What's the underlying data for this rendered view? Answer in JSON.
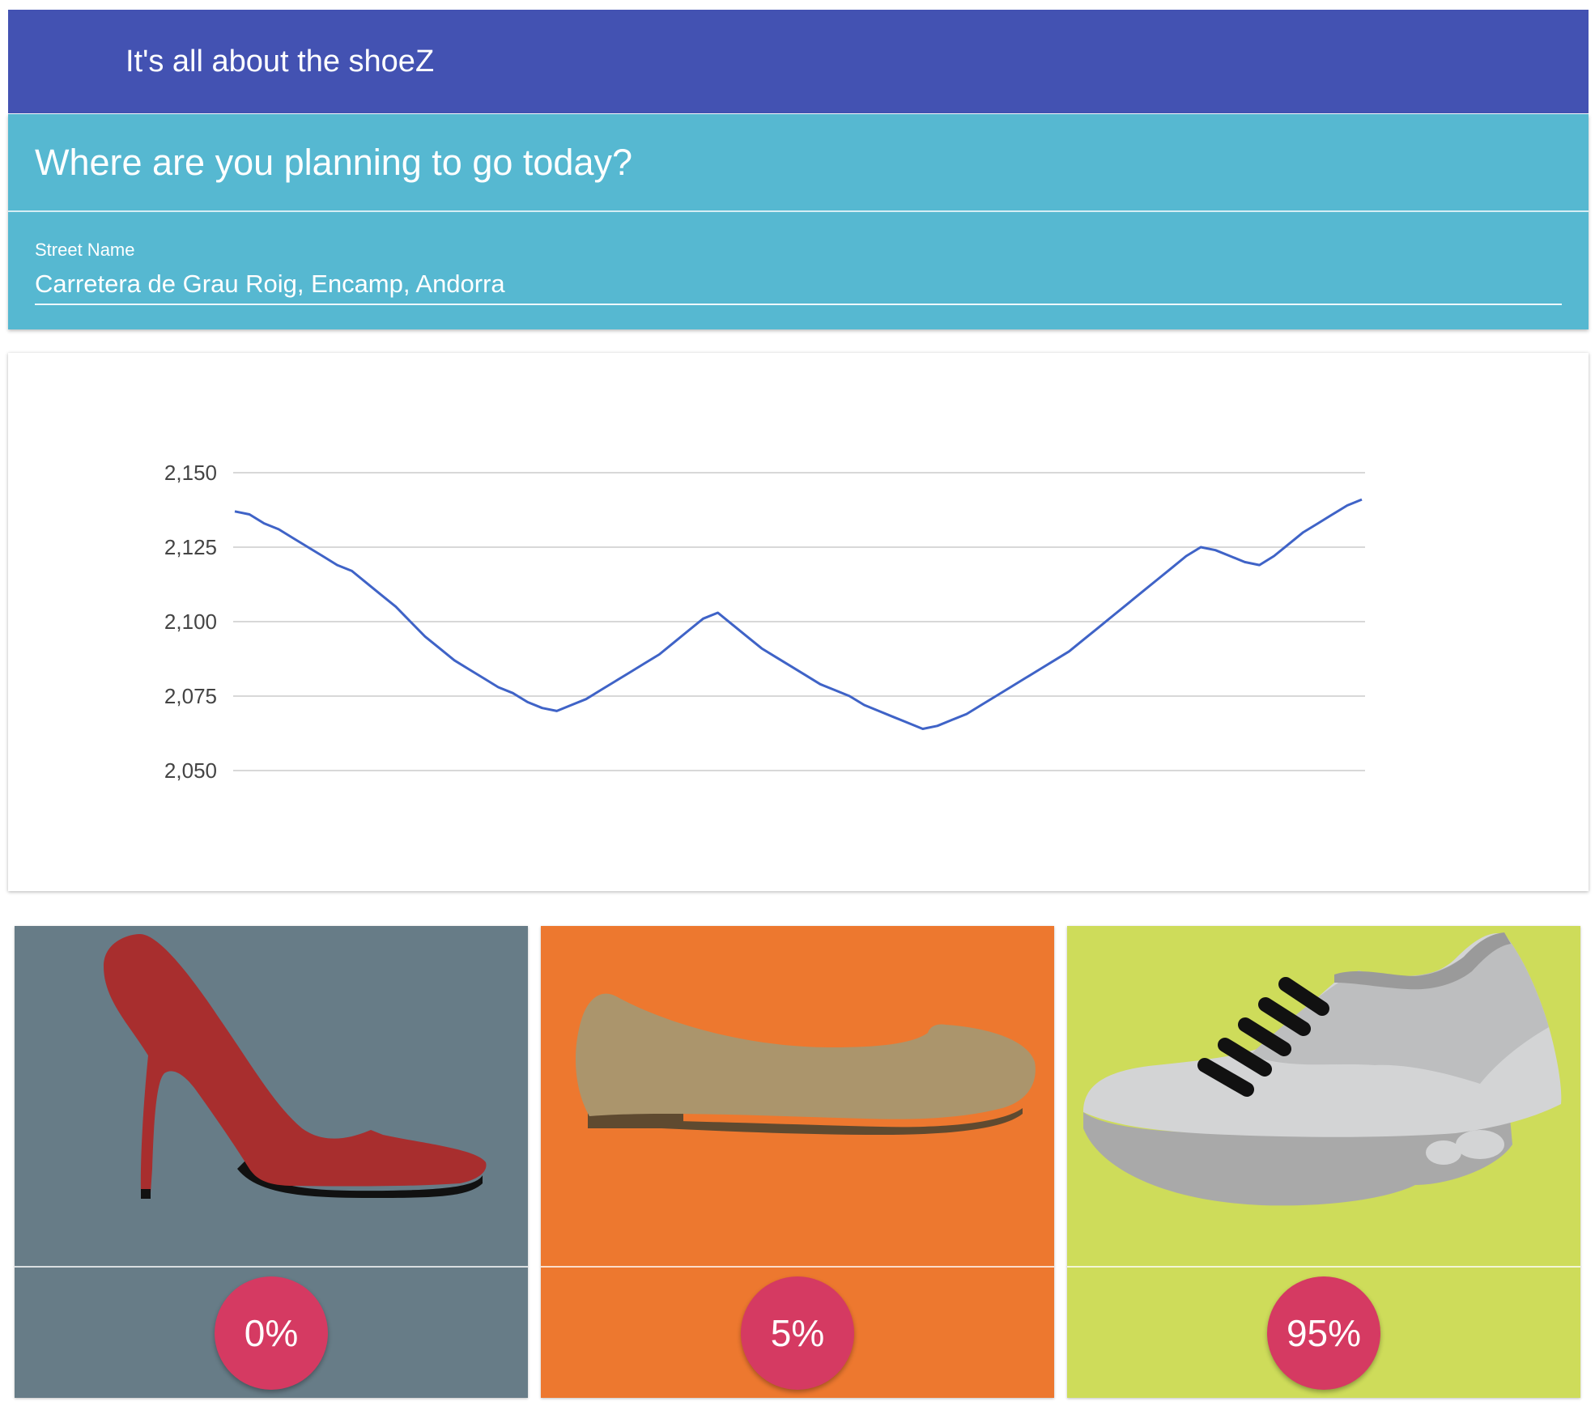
{
  "app": {
    "title": "It's all about the shoeZ",
    "toolbar_color": "#4352b2"
  },
  "search": {
    "heading": "Where are you planning to go today?",
    "field_label": "Street Name",
    "field_value": "Carretera de Grau Roig, Encamp, Andorra",
    "card_color": "#56b8d1"
  },
  "chart_data": {
    "type": "line",
    "title": "",
    "xlabel": "",
    "ylabel": "",
    "ylim": [
      2050,
      2150
    ],
    "yticks": [
      2050,
      2075,
      2100,
      2125,
      2150
    ],
    "ytick_labels": [
      "2,050",
      "2,075",
      "2,100",
      "2,125",
      "2,150"
    ],
    "grid": true,
    "legend": "none",
    "series": [
      {
        "color": "#3f63c7",
        "values": [
          2137,
          2136,
          2133,
          2131,
          2128,
          2125,
          2122,
          2119,
          2117,
          2113,
          2109,
          2105,
          2100,
          2095,
          2091,
          2087,
          2084,
          2081,
          2078,
          2076,
          2073,
          2071,
          2070,
          2072,
          2074,
          2077,
          2080,
          2083,
          2086,
          2089,
          2093,
          2097,
          2101,
          2103,
          2099,
          2095,
          2091,
          2088,
          2085,
          2082,
          2079,
          2077,
          2075,
          2072,
          2070,
          2068,
          2066,
          2064,
          2065,
          2067,
          2069,
          2072,
          2075,
          2078,
          2081,
          2084,
          2087,
          2090,
          2094,
          2098,
          2102,
          2106,
          2110,
          2114,
          2118,
          2122,
          2125,
          2124,
          2122,
          2120,
          2119,
          2122,
          2126,
          2130,
          2133,
          2136,
          2139,
          2141
        ]
      }
    ]
  },
  "cards": [
    {
      "shoe": "high-heel",
      "percent": "0%",
      "bg": "#677c87"
    },
    {
      "shoe": "flat",
      "percent": "5%",
      "bg": "#ed782f"
    },
    {
      "shoe": "sneaker",
      "percent": "95%",
      "bg": "#cedc5a"
    }
  ]
}
